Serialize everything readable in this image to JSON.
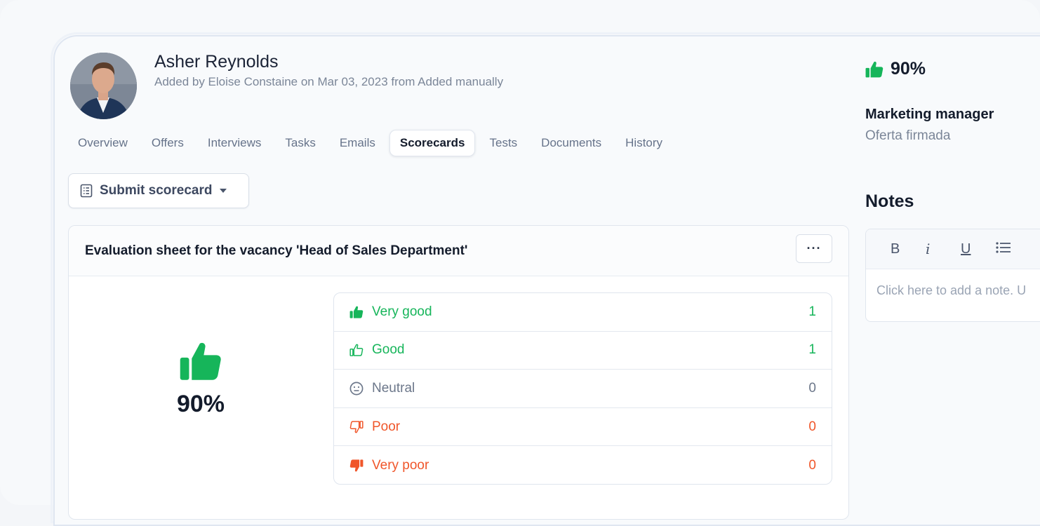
{
  "candidate": {
    "name": "Asher Reynolds",
    "added_info": "Added by Eloise Constaine on Mar 03, 2023 from Added manually"
  },
  "tabs": [
    {
      "label": "Overview",
      "active": false
    },
    {
      "label": "Offers",
      "active": false
    },
    {
      "label": "Interviews",
      "active": false
    },
    {
      "label": "Tasks",
      "active": false
    },
    {
      "label": "Emails",
      "active": false
    },
    {
      "label": "Scorecards",
      "active": true
    },
    {
      "label": "Tests",
      "active": false
    },
    {
      "label": "Documents",
      "active": false
    },
    {
      "label": "History",
      "active": false
    }
  ],
  "toolbar": {
    "submit_label": "Submit scorecard",
    "more_label": "···"
  },
  "evaluation": {
    "title": "Evaluation sheet for the vacancy 'Head of Sales Department'",
    "score": "90%",
    "ratings": [
      {
        "label": "Very good",
        "count": "1",
        "color": "#16b55a",
        "icon": "thumbs-up-filled-icon"
      },
      {
        "label": "Good",
        "count": "1",
        "color": "#16b55a",
        "icon": "thumbs-up-outline-icon"
      },
      {
        "label": "Neutral",
        "count": "0",
        "color": "#6c778a",
        "icon": "neutral-face-icon"
      },
      {
        "label": "Poor",
        "count": "0",
        "color": "#f0562a",
        "icon": "thumbs-down-outline-icon"
      },
      {
        "label": "Very poor",
        "count": "0",
        "color": "#f0562a",
        "icon": "thumbs-down-filled-icon"
      }
    ]
  },
  "side": {
    "score": "90%",
    "job_title": "Marketing manager",
    "job_status": "Oferta firmada",
    "notes_title": "Notes",
    "notes_placeholder": "Click here to add a note. U",
    "tools": [
      "B",
      "i",
      "U"
    ]
  },
  "colors": {
    "accent_green": "#16b55a",
    "accent_orange": "#f0562a",
    "text_dark": "#141c2c"
  }
}
